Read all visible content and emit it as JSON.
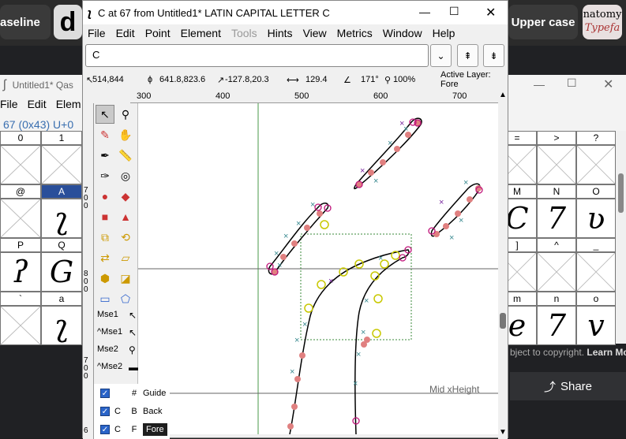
{
  "browser": {
    "tab_left": "aseline",
    "tab_left2": "d",
    "upper_case_btn": "Upper case",
    "anatomy_line1": "natomy",
    "anatomy_line2": "Typefa",
    "copyright_text": "bject to copyright.",
    "learn_more": "Learn Mo",
    "share_label": "Share"
  },
  "fontview": {
    "title": "Untitled1*  Qas",
    "menu": [
      "File",
      "Edit",
      "Elem"
    ],
    "info": "67 (0x43) U+0",
    "left_headers": [
      [
        "0",
        "1"
      ],
      [
        "@",
        "A"
      ],
      [
        "P",
        "Q"
      ],
      [
        "`",
        "a"
      ]
    ],
    "right_headers": [
      [
        "=",
        ">",
        "?"
      ],
      [
        "M",
        "N",
        "O"
      ],
      [
        "]",
        "^",
        "_"
      ],
      [
        "m",
        "n",
        "o"
      ]
    ],
    "left_glyphs": [
      [
        "",
        ""
      ],
      [
        "",
        "ʅ"
      ],
      [
        "ʔ",
        "G"
      ],
      [
        "",
        "ʅ"
      ]
    ],
    "right_glyphs": [
      [
        "",
        "",
        ""
      ],
      [
        "C",
        "7",
        "ʋ"
      ],
      [
        "",
        "",
        ""
      ],
      [
        "e",
        "7",
        "v"
      ]
    ],
    "row_nums": [
      "7",
      "0",
      "0",
      "8",
      "0",
      "0",
      "7",
      "0",
      "0",
      "6"
    ]
  },
  "window": {
    "title": "C at 67 from Untitled1* LATIN CAPITAL LETTER C",
    "menu": [
      "File",
      "Edit",
      "Point",
      "Element",
      "Tools",
      "Hints",
      "View",
      "Metrics",
      "Window",
      "Help"
    ],
    "glyph_name": "C",
    "status": {
      "cursor": "514,844",
      "point": "641.8,823.6",
      "delta": "-127.8,20.3",
      "distance": "129.4",
      "angle": "171°",
      "zoom": "100%",
      "active_layer": "Active Layer: Fore"
    },
    "ruler_ticks": [
      "300",
      "400",
      "500",
      "600",
      "700"
    ],
    "mouse_labels": [
      "Mse1",
      "^Mse1",
      "Mse2",
      "^Mse2"
    ],
    "layers": [
      {
        "col1": "",
        "col2": "#",
        "name": "Guide"
      },
      {
        "col1": "C",
        "col2": "B",
        "name": "Back"
      },
      {
        "col1": "C",
        "col2": "F",
        "name": "Fore"
      }
    ],
    "canvas_label": "Mid xHeight"
  },
  "colors": {
    "accent": "#2a64c8",
    "selected_cell": "#2a4f9a",
    "point_on": "#e07878",
    "point_ctrl": "#7a2ba0",
    "hint": "#3a8a90"
  }
}
